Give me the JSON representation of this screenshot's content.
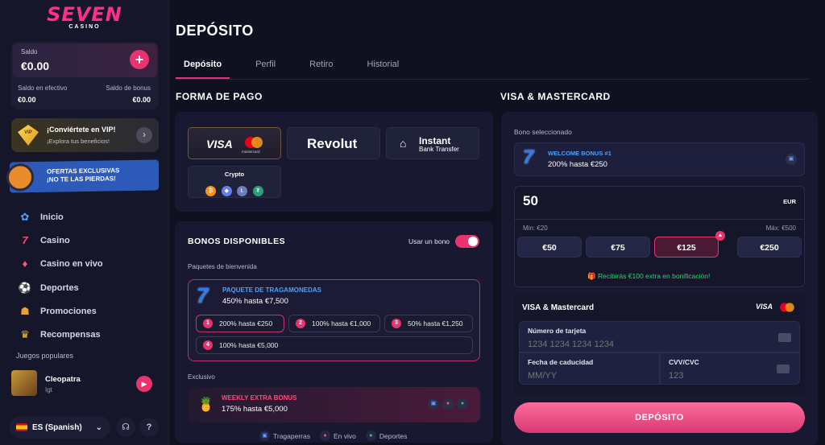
{
  "brand": {
    "name": "SEVEN",
    "sub": "CASINO"
  },
  "balance": {
    "label": "Saldo",
    "value": "€0.00",
    "cash_label": "Saldo en efectivo",
    "cash_value": "€0.00",
    "bonus_label": "Saldo de bonus",
    "bonus_value": "€0.00"
  },
  "vip": {
    "badge": "VIP",
    "title": "¡Conviértete en VIP!",
    "subtitle": "¡Explora tus beneficios!"
  },
  "offers": {
    "line1": "OFERTAS EXCLUSIVAS",
    "line2": "¡NO TE LAS PIERDAS!"
  },
  "nav": [
    {
      "label": "Inicio"
    },
    {
      "label": "Casino"
    },
    {
      "label": "Casino en vivo"
    },
    {
      "label": "Deportes"
    },
    {
      "label": "Promociones"
    },
    {
      "label": "Recompensas"
    }
  ],
  "popular": {
    "label": "Juegos populares",
    "game": "Cleopatra",
    "provider": "Igt"
  },
  "language": {
    "label": "ES (Spanish)"
  },
  "page": {
    "title": "DEPÓSITO"
  },
  "tabs": [
    "Depósito",
    "Perfil",
    "Retiro",
    "Historial"
  ],
  "payment": {
    "section_title": "FORMA DE PAGO",
    "methods": {
      "visa": "VISA",
      "mastercard": "mastercard",
      "revolut": "Revolut",
      "instant": "Instant",
      "bank_transfer": "Bank Transfer",
      "crypto": "Crypto"
    }
  },
  "bonuses": {
    "title": "BONOS DISPONIBLES",
    "toggle_label": "Usar un bono",
    "group_label": "Paquetes de bienvenida",
    "pack": {
      "name": "PAQUETE DE TRAGAMONEDAS",
      "desc": "450% hasta €7,500",
      "seven": "7"
    },
    "options": [
      {
        "num": "1",
        "label": "200% hasta €250"
      },
      {
        "num": "2",
        "label": "100% hasta €1,000"
      },
      {
        "num": "3",
        "label": "50% hasta €1,250"
      },
      {
        "num": "4",
        "label": "100% hasta €5,000"
      }
    ],
    "exclusive_label": "Exclusivo",
    "weekly": {
      "name": "WEEKLY EXTRA BONUS",
      "desc": "175% hasta €5,000"
    },
    "categories": [
      "Tragaperras",
      "En vivo",
      "Deportes"
    ]
  },
  "right": {
    "title": "VISA & MASTERCARD",
    "selected_label": "Bono seleccionado",
    "selected": {
      "name": "WELCOME BONUS #1",
      "desc": "200% hasta €250",
      "seven": "7"
    },
    "amount": {
      "value": "50",
      "currency": "EUR",
      "min": "Min: €20",
      "max": "Máx: €500"
    },
    "chips": [
      "€50",
      "€75",
      "€125",
      "€250"
    ],
    "extra_note": "Recibirás €100 extra en bonificación!",
    "card": {
      "title": "VISA & Mastercard",
      "visa": "VISA",
      "number_label": "Número de tarjeta",
      "number_placeholder": "1234 1234 1234 1234",
      "expiry_label": "Fecha de caducidad",
      "expiry_placeholder": "MM/YY",
      "cvv_label": "CVV/CVC",
      "cvv_placeholder": "123"
    },
    "deposit_button": "DEPÓSITO"
  },
  "colors": {
    "accent": "#e8336e",
    "bg": "#0f1020",
    "panel": "#181930"
  }
}
